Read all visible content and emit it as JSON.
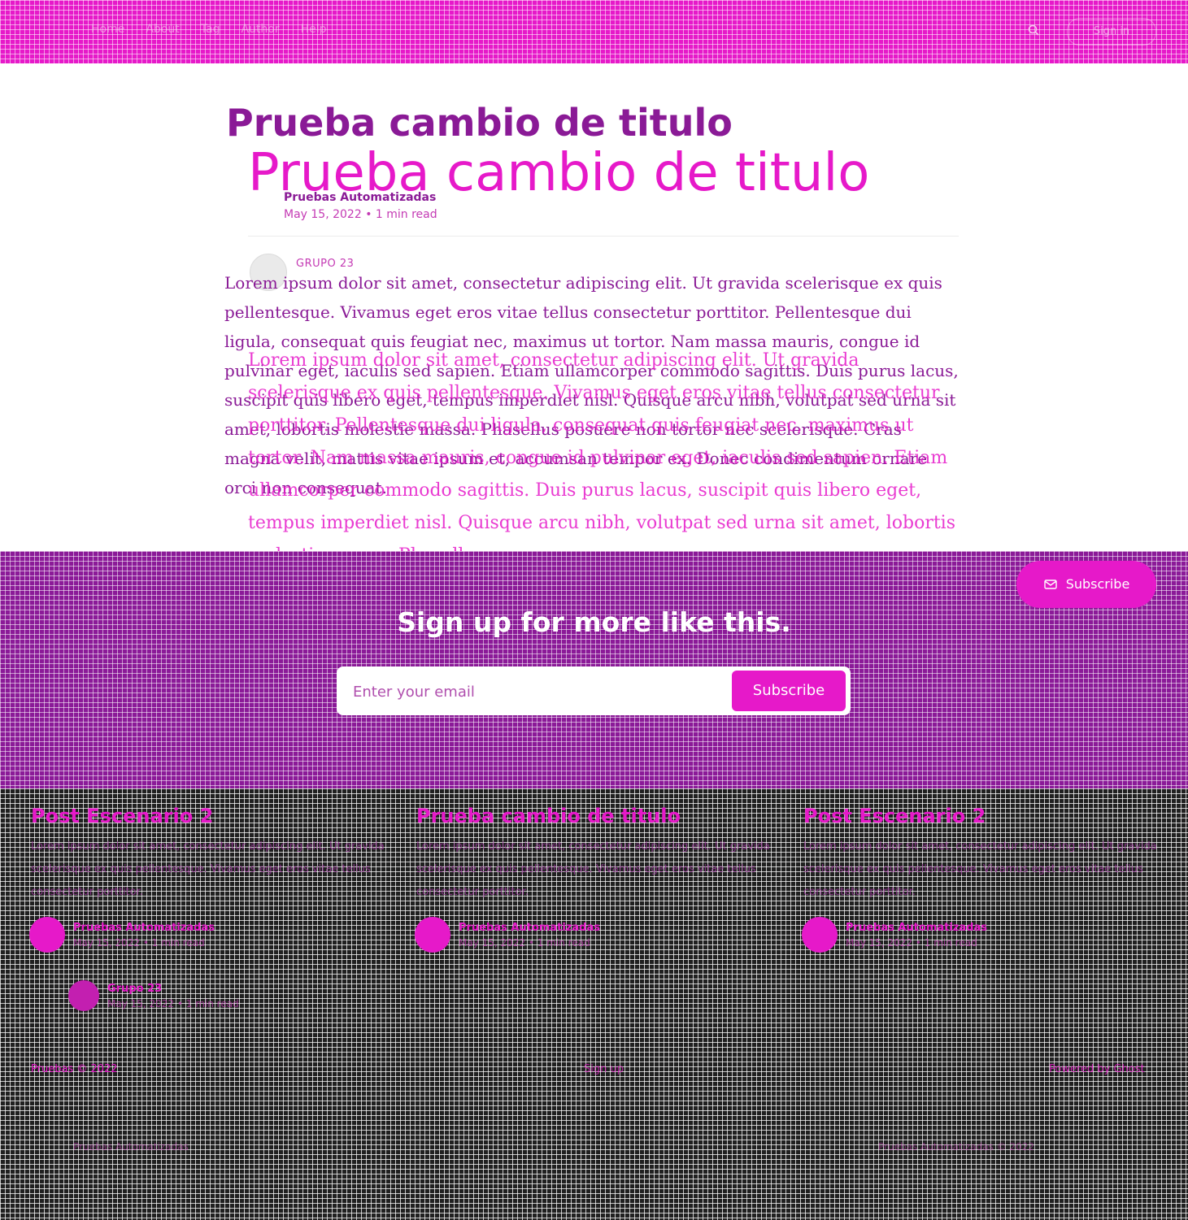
{
  "header": {
    "nav": [
      "Home",
      "About",
      "Tag",
      "Author",
      "Help"
    ],
    "signin_label": "Sign in",
    "search_icon": "search-icon"
  },
  "post": {
    "ghost_title": "Prueba cambio de titulo",
    "title": "Prueba cambio de titulo",
    "author_name": "Pruebas Automatizadas",
    "meta": "May 15, 2022 • 1 min read",
    "author_label": "GRUPO 23",
    "ghost_body": "Lorem ipsum dolor sit amet, consectetur adipiscing elit. Ut gravida scelerisque ex quis pellentesque. Vivamus eget eros vitae tellus consectetur porttitor. Pellentesque dui ligula, consequat quis feugiat nec, maximus ut tortor. Nam massa mauris, congue id pulvinar eget, iaculis sed sapien. Etiam ullamcorper commodo sagittis. Duis purus lacus, suscipit quis libero eget, tempus imperdiet nisl. Quisque arcu nibh, volutpat sed urna sit amet, lobortis molestie massa. Phasellus posuere non tortor nec scelerisque. Cras magna velit, mattis vitae ipsum et, accumsan tempor ex. Donec condimentum ornare orci non consequat.",
    "body": "Lorem ipsum dolor sit amet, consectetur adipiscing elit. Ut gravida scelerisque ex quis pellentesque. Vivamus eget eros vitae tellus consectetur porttitor. Pellentesque dui ligula, consequat quis feugiat nec, maximus ut tortor. Nam massa mauris, congue id pulvinar eget, iaculis sed sapien. Etiam ullamcorper commodo sagittis. Duis purus lacus, suscipit quis libero eget, tempus imperdiet nisl. Quisque arcu nibh, volutpat sed urna sit amet, lobortis molestie massa. Phasellus"
  },
  "subscribe": {
    "floating_label": "Subscribe",
    "heading": "Sign up for more like this.",
    "email_placeholder": "Enter your email",
    "button_label": "Subscribe"
  },
  "related": [
    {
      "title": "Post Escenario 2",
      "excerpt": "Lorem ipsum dolor sit amet, consectetur adipiscing elit. Ut gravida scelerisque ex quis pellentesque. Vivamus eget eros vitae tellus consectetur porttitor.",
      "author": "Pruebas Automatizadas",
      "meta": "May 15, 2022 • 1 min read"
    },
    {
      "title": "Prueba cambio de titulo",
      "excerpt": "Lorem ipsum dolor sit amet, consectetur adipiscing elit. Ut gravida scelerisque ex quis pellentesque. Vivamus eget eros vitae tellus consectetur porttitor.",
      "author": "Pruebas Automatizadas",
      "meta": "May 15, 2022 • 1 min read"
    },
    {
      "title": "Post Escenario 2",
      "excerpt": "Lorem ipsum dolor sit amet, consectetur adipiscing elit. Ut gravida scelerisque ex quis pellentesque. Vivamus eget eros vitae tellus consectetur porttitor.",
      "author": "Pruebas Automatizadas",
      "meta": "May 15, 2022 • 1 min read"
    }
  ],
  "extra_author": {
    "name": "Grupo 23",
    "meta": "May 15, 2022 • 1 min read"
  },
  "footer": {
    "left": "Pruebas © 2022",
    "mid": "Sign up",
    "right": "Powered by Ghost",
    "bottom_left": "Pruebas Automatizadas",
    "bottom_right": "Pruebas Automatizadas © 2022"
  },
  "colors": {
    "accent": "#e619c9",
    "section": "#8b1a98",
    "footer": "#202020"
  }
}
